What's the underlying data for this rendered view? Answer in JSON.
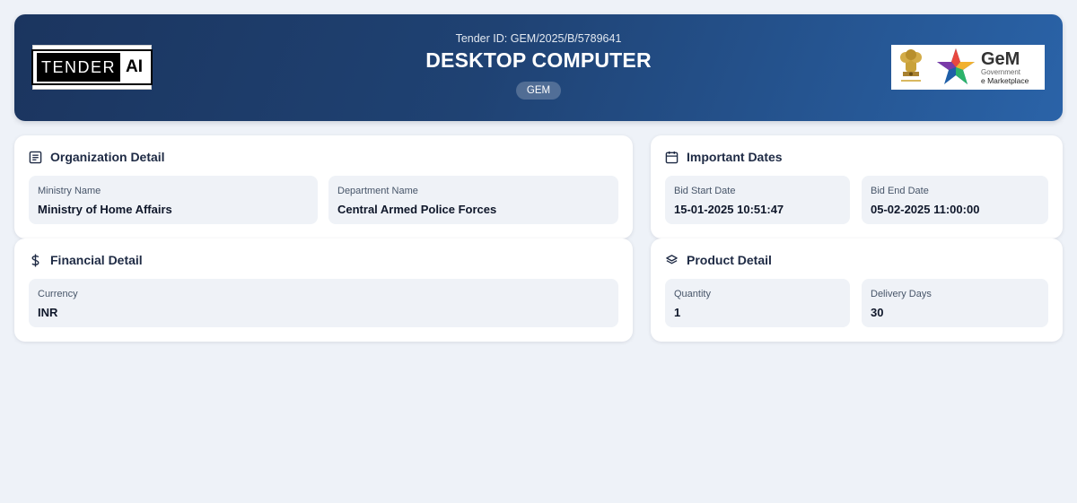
{
  "header": {
    "logo_left": {
      "word1": "TENDER",
      "word2": "AI"
    },
    "tender_id": "Tender ID: GEM/2025/B/5789641",
    "title": "DESKTOP COMPUTER",
    "badge": "GEM",
    "logo_right": {
      "brand": "GeM",
      "line1": "Government",
      "line2": "e Marketplace"
    }
  },
  "organization": {
    "title": "Organization Detail",
    "icon": "document-icon",
    "fields": [
      {
        "label": "Ministry Name",
        "value": "Ministry of Home Affairs"
      },
      {
        "label": "Department Name",
        "value": "Central Armed Police Forces"
      }
    ]
  },
  "dates": {
    "title": "Important Dates",
    "icon": "calendar-icon",
    "fields": [
      {
        "label": "Bid Start Date",
        "value": "15-01-2025 10:51:47"
      },
      {
        "label": "Bid End Date",
        "value": "05-02-2025 11:00:00"
      }
    ]
  },
  "financial": {
    "title": "Financial Detail",
    "icon": "dollar-icon",
    "fields": [
      {
        "label": "Currency",
        "value": "INR"
      }
    ]
  },
  "product": {
    "title": "Product Detail",
    "icon": "layers-icon",
    "fields": [
      {
        "label": "Quantity",
        "value": "1"
      },
      {
        "label": "Delivery Days",
        "value": "30"
      }
    ]
  },
  "colors": {
    "page_bg": "#eef2f8",
    "header_gradient_start": "#1b355f",
    "header_gradient_end": "#2a63a8",
    "field_bg": "#eff2f7",
    "card_title": "#1e2a44"
  }
}
